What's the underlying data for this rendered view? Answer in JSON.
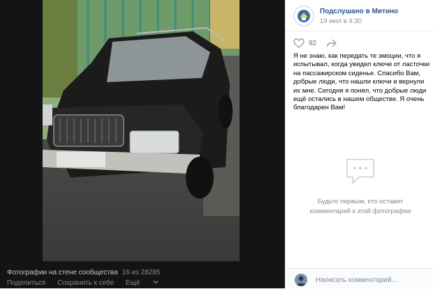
{
  "post": {
    "author_name": "Подслушано в Митино",
    "date": "19 июл в 4:30",
    "likes": "92",
    "caption": "Я не знаю, как передать те эмоции, что я испытывал, когда увидел ключи от ласточки на пассажирском сиденье. Спасибо Вам, добрые люди, что нашли ключи и вернули их мне. Сегодня я понял, что добрые люди ещё остались в нашем обществе. Я очень благодарен Вам!"
  },
  "comments": {
    "empty_line1": "Будьте первым, кто оставит",
    "empty_line2": "комментарий к этой фотографии",
    "placeholder": "Написать комментарий..."
  },
  "photo_footer": {
    "album": "Фотографии на стене сообщества",
    "counter": "16 из 28285",
    "share_label": "Поделиться",
    "save_label": "Сохранить к себе",
    "more_label": "Ещё"
  },
  "colors": {
    "link": "#2a5885",
    "muted": "#818c99",
    "viewer_bg": "#141414"
  },
  "icons": [
    "heart-icon",
    "share-arrow-icon",
    "comment-bubble-icon",
    "chevron-down-icon"
  ]
}
